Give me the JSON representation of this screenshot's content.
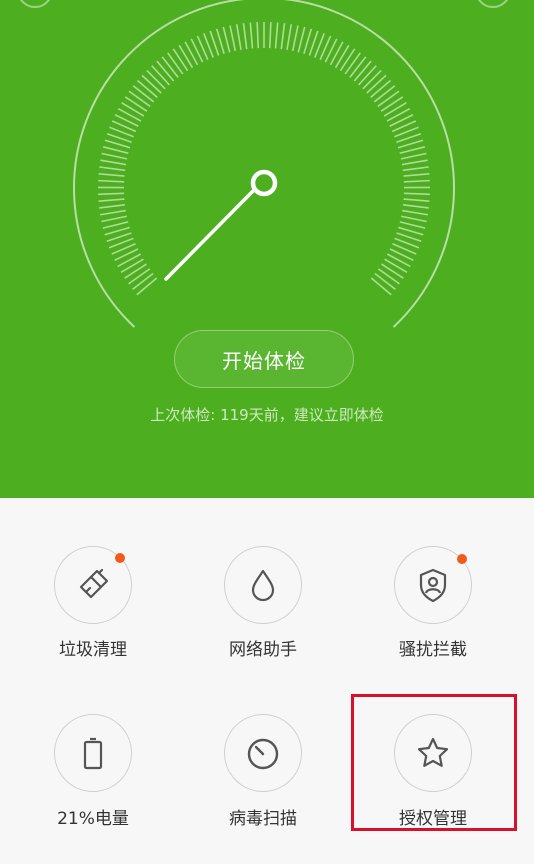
{
  "hero": {
    "start_button": "开始体检",
    "last_check_text": "上次体检: 119天前，建议立即体检",
    "background_color": "#4daf1f"
  },
  "tools": [
    {
      "label": "垃圾清理",
      "icon": "brush-icon",
      "has_badge": true
    },
    {
      "label": "网络助手",
      "icon": "droplet-icon",
      "has_badge": false
    },
    {
      "label": "骚扰拦截",
      "icon": "shield-user-icon",
      "has_badge": true
    },
    {
      "label": "21%电量",
      "icon": "battery-icon",
      "has_badge": false
    },
    {
      "label": "病毒扫描",
      "icon": "scan-dial-icon",
      "has_badge": false
    },
    {
      "label": "授权管理",
      "icon": "star-icon",
      "has_badge": false
    }
  ],
  "colors": {
    "badge": "#f25a1a",
    "highlight_box": "#d8102a"
  }
}
